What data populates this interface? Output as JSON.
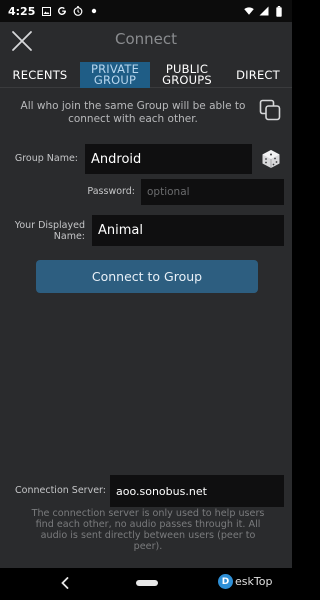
{
  "status_bar": {
    "time": "4:25",
    "icons_left": [
      "image-icon",
      "g-icon",
      "clock-icon",
      "dot-icon"
    ],
    "icons_right": [
      "wifi-icon",
      "signal-icon",
      "battery-icon"
    ]
  },
  "header": {
    "title": "Connect",
    "close_icon": "close-icon"
  },
  "tabs": [
    {
      "label": "RECENTS",
      "active": false
    },
    {
      "label": "PRIVATE GROUP",
      "active": true
    },
    {
      "label": "PUBLIC GROUPS",
      "active": false
    },
    {
      "label": "DIRECT",
      "active": false
    }
  ],
  "info_text": "All who join the same Group will be able to connect with each other.",
  "form": {
    "group_label": "Group Name:",
    "group_value": "Android",
    "password_label": "Password:",
    "password_placeholder": "optional",
    "name_label": "Your Displayed Name:",
    "name_value": "Animal",
    "connect_label": "Connect to Group"
  },
  "server": {
    "label": "Connection Server:",
    "value": "aoo.sonobus.net",
    "note": "The connection server is only used to help users find each other, no audio passes through it. All audio is sent directly between users (peer to peer)."
  },
  "watermark": {
    "logo_letter": "D",
    "text": "eskTop"
  },
  "colors": {
    "background": "#2a2b2d",
    "tab_active": "#1f5d86",
    "button": "#2d5e80",
    "field": "#0f0f10"
  }
}
